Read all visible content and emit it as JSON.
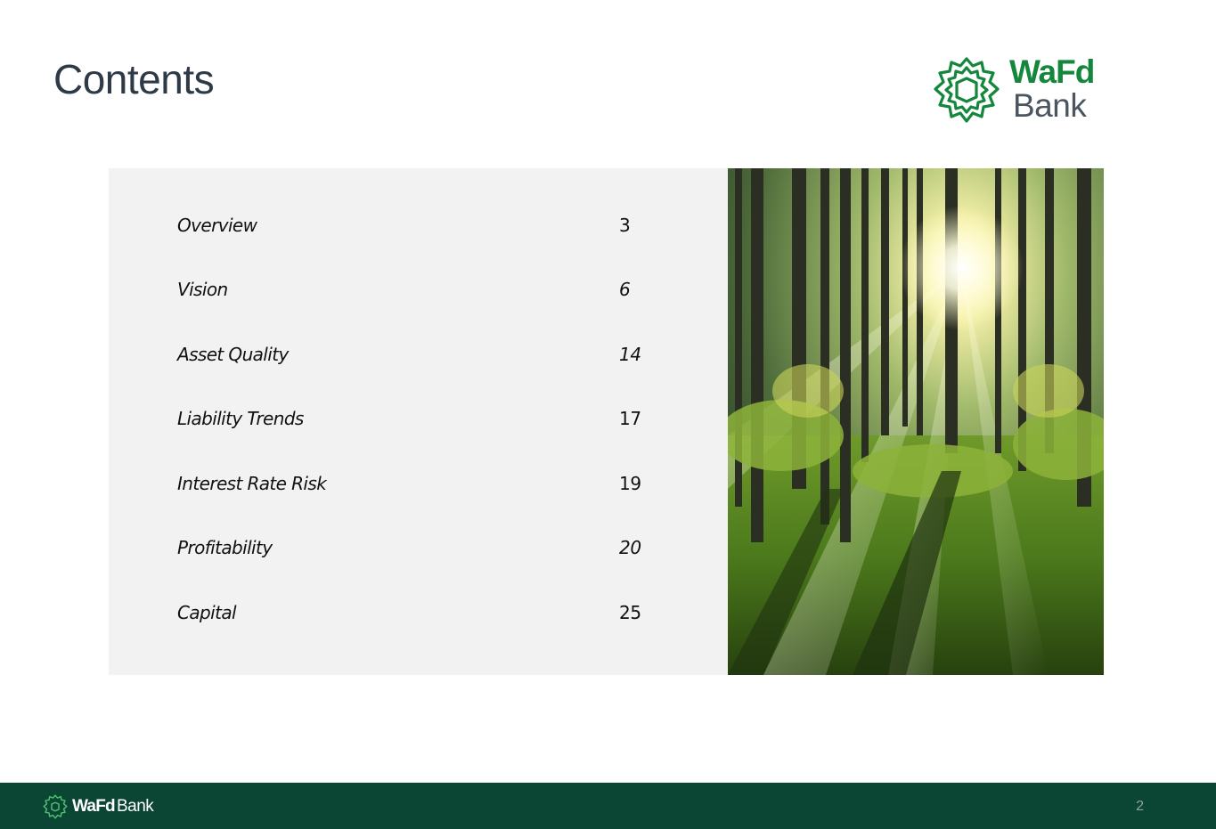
{
  "slide": {
    "title": "Contents",
    "page_number": "2"
  },
  "logo": {
    "word1": "WaFd",
    "word2": "Bank",
    "brand_green": "#14873c",
    "text_gray": "#4a5560"
  },
  "toc": {
    "items": [
      {
        "label": "Overview",
        "page": "3"
      },
      {
        "label": "Vision",
        "page": "6"
      },
      {
        "label": "Asset Quality",
        "page": "14"
      },
      {
        "label": "Liability Trends",
        "page": "17"
      },
      {
        "label": "Interest Rate Risk",
        "page": "19"
      },
      {
        "label": "Profitability",
        "page": "20"
      },
      {
        "label": "Capital",
        "page": "25"
      }
    ]
  },
  "footer": {
    "word1": "WaFd",
    "word2": "Bank",
    "background": "#0b4533"
  },
  "icons": {
    "logo_mark": "wafd-emblem-icon",
    "footer_mark": "wafd-emblem-icon"
  }
}
